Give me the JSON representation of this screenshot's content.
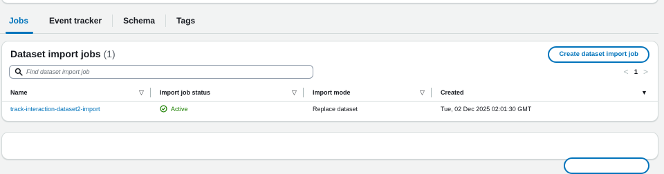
{
  "tabs": [
    {
      "label": "Jobs",
      "active": true
    },
    {
      "label": "Event tracker",
      "active": false
    },
    {
      "label": "Schema",
      "active": false
    },
    {
      "label": "Tags",
      "active": false
    }
  ],
  "panel": {
    "title": "Dataset import jobs",
    "count": "(1)",
    "create_button": "Create dataset import job",
    "search_placeholder": "Find dataset import job",
    "pagination": {
      "prev": "<",
      "page": "1",
      "next": ">"
    }
  },
  "table": {
    "columns": [
      "Name",
      "Import job status",
      "Import mode",
      "Created"
    ],
    "rows": [
      {
        "name": "track-interaction-dataset2-import",
        "status": "Active",
        "mode": "Replace dataset",
        "created": "Tue, 02 Dec 2025 02:01:30 GMT"
      }
    ]
  },
  "colors": {
    "accent": "#0073bb",
    "success": "#1d8102"
  },
  "icons": {
    "search": "search-icon",
    "status": "check-circle-icon",
    "sort": "sort-down-icon"
  }
}
